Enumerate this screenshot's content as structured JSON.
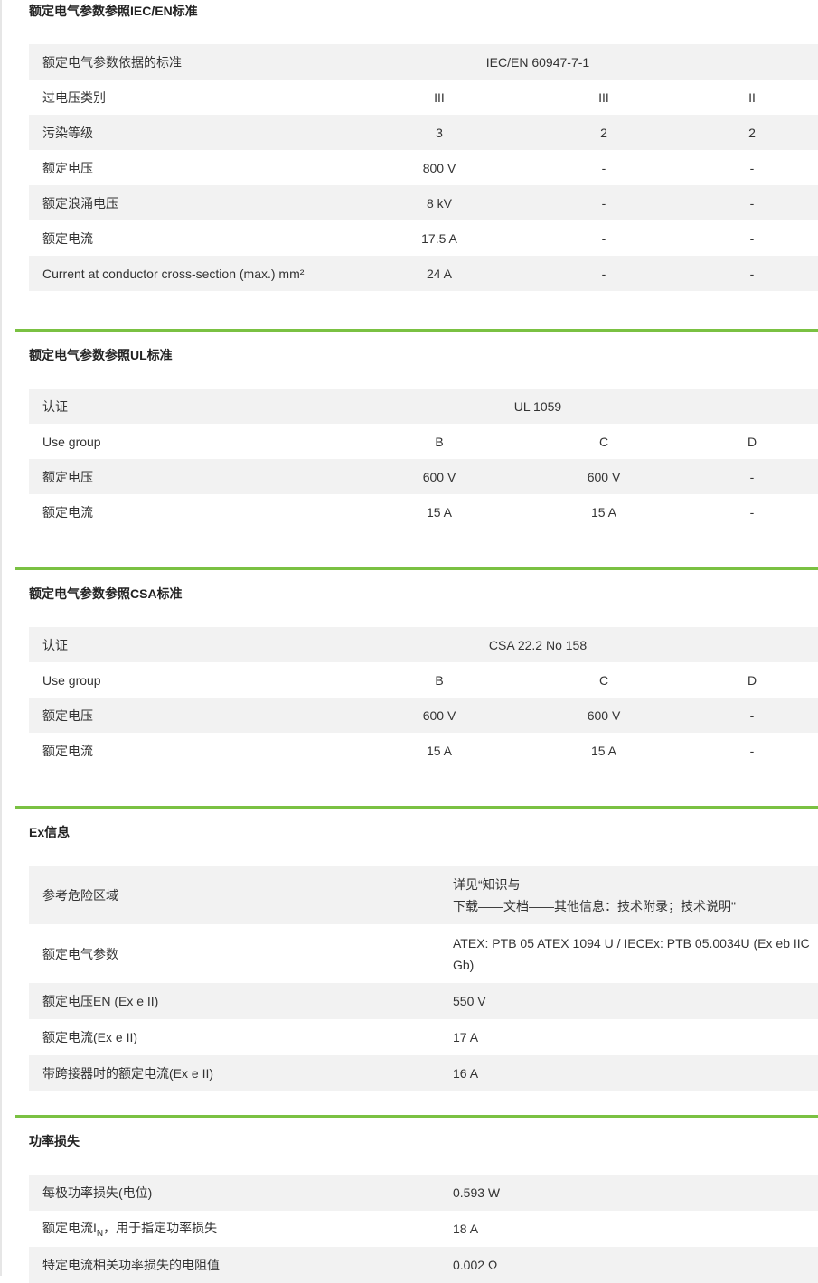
{
  "iec": {
    "title": "额定电气参数参照IEC/EN标准",
    "rows": [
      {
        "label": "额定电气参数依据的标准",
        "span": "IEC/EN 60947-7-1"
      },
      {
        "label": "过电压类别",
        "v": [
          "III",
          "III",
          "II"
        ]
      },
      {
        "label": "污染等级",
        "v": [
          "3",
          "2",
          "2"
        ]
      },
      {
        "label": "额定电压",
        "v": [
          "800 V",
          "-",
          "-"
        ]
      },
      {
        "label": "额定浪涌电压",
        "v": [
          "8 kV",
          "-",
          "-"
        ]
      },
      {
        "label": "额定电流",
        "v": [
          "17.5 A",
          "-",
          "-"
        ]
      },
      {
        "label": "Current at conductor cross-section (max.) mm²",
        "v": [
          "24 A",
          "-",
          "-"
        ]
      }
    ]
  },
  "ul": {
    "title": "额定电气参数参照UL标准",
    "rows": [
      {
        "label": "认证",
        "span": "UL 1059"
      },
      {
        "label": "Use group",
        "v": [
          "B",
          "C",
          "D"
        ]
      },
      {
        "label": "额定电压",
        "v": [
          "600 V",
          "600 V",
          "-"
        ]
      },
      {
        "label": "额定电流",
        "v": [
          "15 A",
          "15 A",
          "-"
        ]
      }
    ]
  },
  "csa": {
    "title": "额定电气参数参照CSA标准",
    "rows": [
      {
        "label": "认证",
        "span": "CSA 22.2 No 158"
      },
      {
        "label": "Use group",
        "v": [
          "B",
          "C",
          "D"
        ]
      },
      {
        "label": "额定电压",
        "v": [
          "600 V",
          "600 V",
          "-"
        ]
      },
      {
        "label": "额定电流",
        "v": [
          "15 A",
          "15 A",
          "-"
        ]
      }
    ]
  },
  "ex": {
    "title": "Ex信息",
    "rows": [
      {
        "label": "参考危险区域",
        "lines": [
          "详见“知识与",
          "下载——文档——其他信息：技术附录；技术说明\""
        ]
      },
      {
        "label": "额定电气参数",
        "lines": [
          "ATEX: PTB 05 ATEX 1094 U / IECEx: PTB 05.0034U (Ex eb IIC",
          "Gb)"
        ]
      },
      {
        "label": "额定电压EN (Ex e II)",
        "value": "550 V"
      },
      {
        "label": "额定电流(Ex e II)",
        "value": "17 A"
      },
      {
        "label": "带跨接器时的额定电流(Ex e II)",
        "value": "16 A"
      }
    ]
  },
  "power": {
    "title": "功率损失",
    "rows": [
      {
        "label": "每极功率损失(电位)",
        "value": "0.593 W"
      },
      {
        "label_pre": "额定电流I",
        "label_sub": "N",
        "label_post": "，用于指定功率损失",
        "value": "18 A"
      },
      {
        "label": "特定电流相关功率损失的电阻值",
        "value": "0.002 Ω"
      }
    ]
  }
}
